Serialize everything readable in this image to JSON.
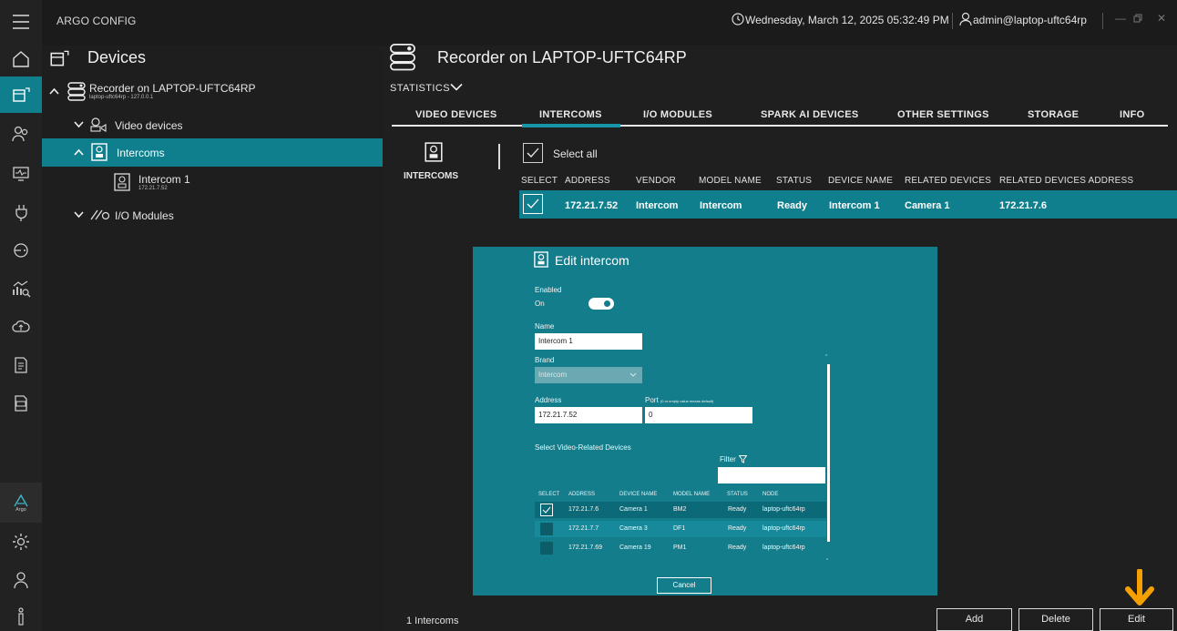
{
  "app": {
    "title": "ARGO CONFIG",
    "datetime": "Wednesday, March 12, 2025 05:32:49 PM",
    "user": "admin@laptop-uftc64rp"
  },
  "sidebar": {
    "title": "Devices",
    "recorder": {
      "label": "Recorder on LAPTOP-UFTC64RP",
      "sub": "laptop-uftc64rp - 127.0.0.1"
    },
    "video_devices": "Video devices",
    "intercoms": "Intercoms",
    "intercom1": {
      "label": "Intercom 1",
      "sub": "172.21.7.52"
    },
    "io_modules": "I/O Modules"
  },
  "main": {
    "title": "Recorder on LAPTOP-UFTC64RP",
    "statistics": "STATISTICS",
    "tabs": [
      "VIDEO DEVICES",
      "INTERCOMS",
      "I/O MODULES",
      "SPARK AI DEVICES",
      "OTHER SETTINGS",
      "STORAGE",
      "INFO"
    ],
    "active_tab": "INTERCOMS",
    "category_label": "INTERCOMS",
    "select_all": "Select all",
    "columns": [
      "SELECT",
      "ADDRESS",
      "VENDOR",
      "MODEL NAME",
      "STATUS",
      "DEVICE NAME",
      "RELATED DEVICES",
      "RELATED DEVICES ADDRESS"
    ],
    "rows": [
      {
        "checked": true,
        "address": "172.21.7.52",
        "vendor": "Intercom",
        "model": "Intercom",
        "status": "Ready",
        "device_name": "Intercom 1",
        "related": "Camera 1",
        "related_address": "172.21.7.6"
      }
    ],
    "count": "1 Intercoms",
    "buttons": {
      "add": "Add",
      "delete": "Delete",
      "edit": "Edit"
    }
  },
  "dialog": {
    "title": "Edit intercom",
    "enabled_label": "Enabled",
    "enabled_state": "On",
    "enabled": true,
    "name_label": "Name",
    "name_value": "Intercom 1",
    "brand_label": "Brand",
    "brand_value": "Intercom",
    "address_label": "Address",
    "address_value": "172.21.7.52",
    "port_label": "Port",
    "port_hint": "(0 or empty value means default)",
    "port_value": "0",
    "related_label": "Select Video-Related Devices",
    "filter_label": "Filter",
    "filter_value": "",
    "columns": [
      "SELECT",
      "ADDRESS",
      "DEVICE NAME",
      "MODEL NAME",
      "STATUS",
      "NODE"
    ],
    "rows": [
      {
        "checked": true,
        "address": "172.21.7.6",
        "device_name": "Camera 1",
        "model": "BM2",
        "status": "Ready",
        "node": "laptop-uftc64rp"
      },
      {
        "checked": false,
        "address": "172.21.7.7",
        "device_name": "Camera 3",
        "model": "DF1",
        "status": "Ready",
        "node": "laptop-uftc64rp"
      },
      {
        "checked": false,
        "address": "172.21.7.69",
        "device_name": "Camera 19",
        "model": "PM1",
        "status": "Ready",
        "node": "laptop-uftc64rp"
      }
    ],
    "cancel": "Cancel"
  },
  "colors": {
    "accent": "#0f7f8e",
    "dialog_bg": "#137d8c",
    "highlight_arrow": "#f5a000"
  },
  "icons": [
    "menu-icon",
    "home-icon",
    "devices-icon",
    "users-icon",
    "monitor-icon",
    "plug-icon",
    "intercom-icon",
    "analytics-icon",
    "cloud-icon",
    "report-icon",
    "log-icon",
    "argo-logo",
    "gear-icon",
    "user-icon",
    "info-icon",
    "list-icon",
    "clock-icon",
    "recorder-icon",
    "camera-icon",
    "io-module-icon",
    "chevron-down-icon",
    "chevron-up-icon",
    "filter-icon",
    "arrow-down-icon"
  ]
}
